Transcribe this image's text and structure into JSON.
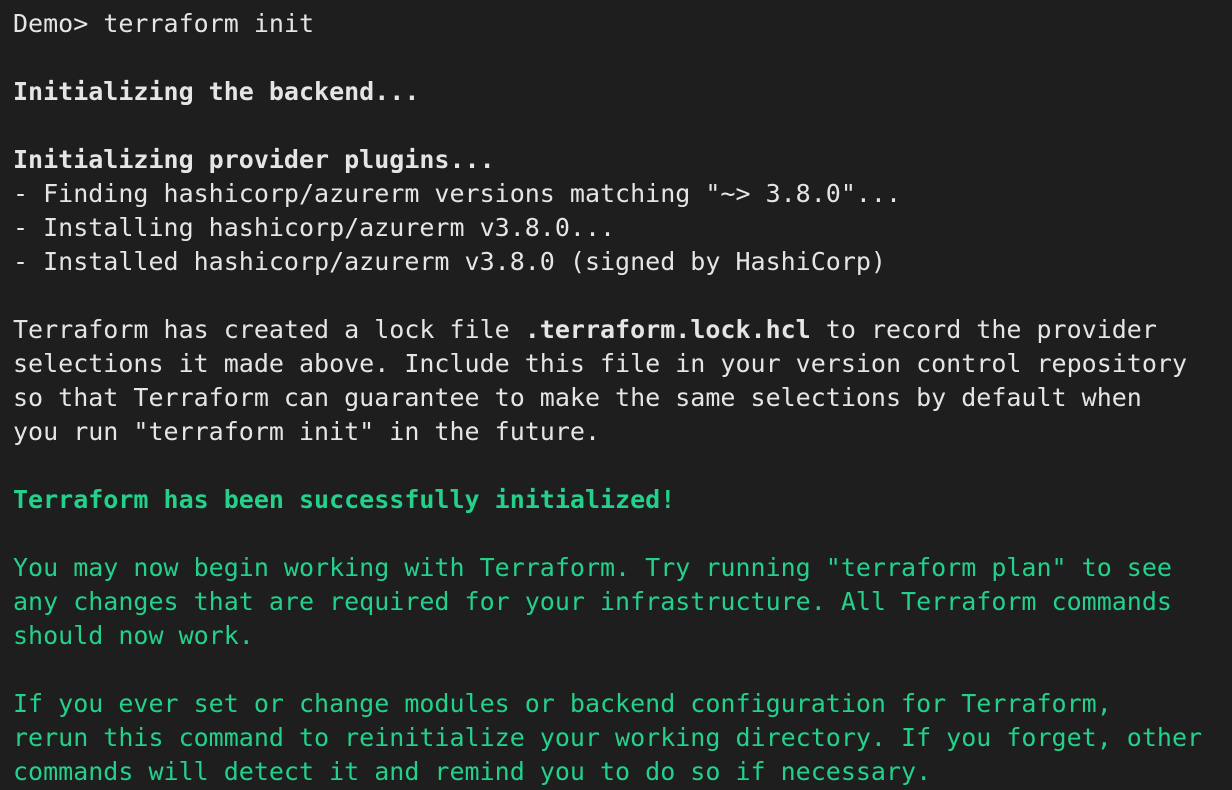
{
  "prompt": "Demo>",
  "command": "terraform init",
  "output": {
    "backend_heading": "Initializing the backend...",
    "plugins_heading": "Initializing provider plugins...",
    "plugin_lines": [
      "- Finding hashicorp/azurerm versions matching \"~> 3.8.0\"...",
      "- Installing hashicorp/azurerm v3.8.0...",
      "- Installed hashicorp/azurerm v3.8.0 (signed by HashiCorp)"
    ],
    "lock_paragraph": {
      "line1_before": "Terraform has created a lock file ",
      "line1_bold": ".terraform.lock.hcl",
      "line1_after": " to record the provider",
      "line2": "selections it made above. Include this file in your version control repository",
      "line3": "so that Terraform can guarantee to make the same selections by default when",
      "line4": "you run \"terraform init\" in the future."
    },
    "success_heading": "Terraform has been successfully initialized!",
    "next_steps": [
      "You may now begin working with Terraform. Try running \"terraform plan\" to see",
      "any changes that are required for your infrastructure. All Terraform commands",
      "should now work."
    ],
    "reinit_note": [
      "If you ever set or change modules or backend configuration for Terraform,",
      "rerun this command to reinitialize your working directory. If you forget, other",
      "commands will detect it and remind you to do so if necessary."
    ]
  },
  "colors": {
    "background": "#1e1e1e",
    "text": "#e5e5e5",
    "success": "#23d18b"
  }
}
